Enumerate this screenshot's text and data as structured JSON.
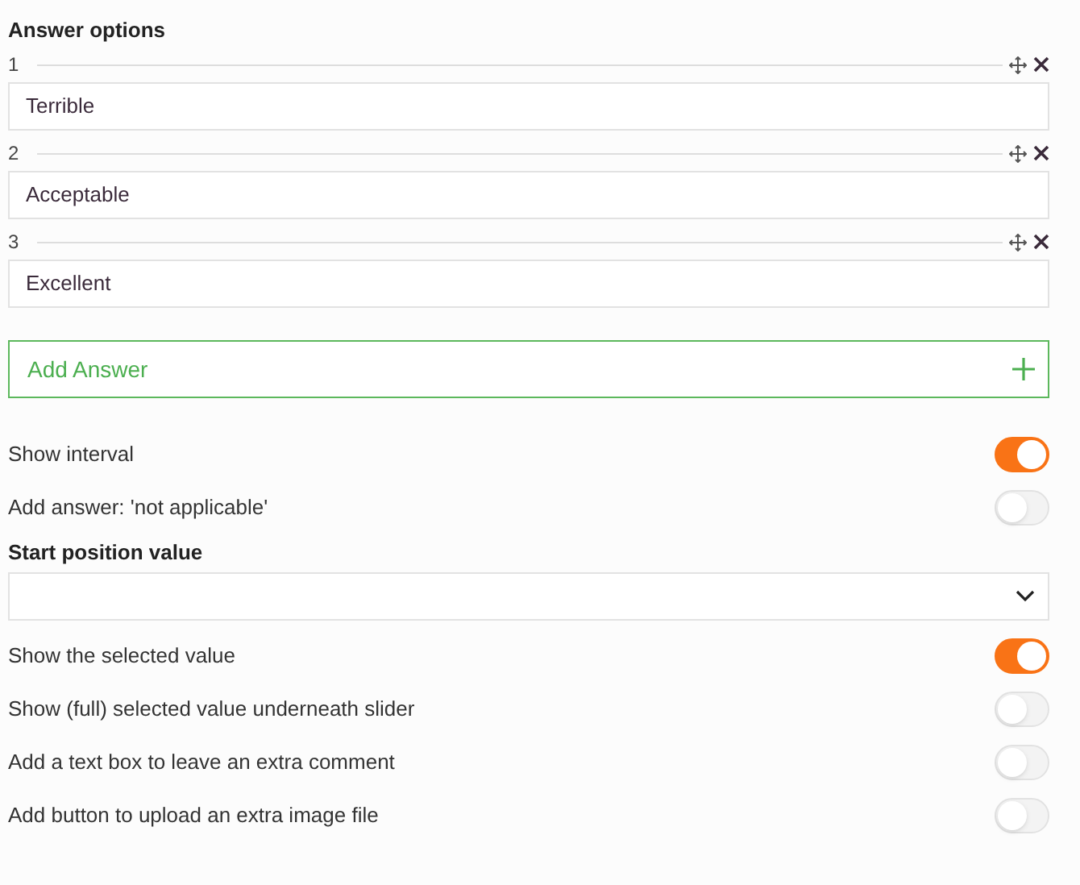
{
  "answer_options": {
    "title": "Answer options",
    "answers": [
      {
        "number": "1",
        "value": "Terrible"
      },
      {
        "number": "2",
        "value": "Acceptable"
      },
      {
        "number": "3",
        "value": "Excellent"
      }
    ],
    "add_button": "Add Answer"
  },
  "settings_top": [
    {
      "label": "Show interval",
      "on": true
    },
    {
      "label": "Add answer: 'not applicable'",
      "on": false
    }
  ],
  "start_position": {
    "label": "Start position value"
  },
  "settings_bottom": [
    {
      "label": "Show the selected value",
      "on": true
    },
    {
      "label": "Show (full) selected value underneath slider",
      "on": false
    },
    {
      "label": "Add a text box to leave an extra comment",
      "on": false
    },
    {
      "label": "Add button to upload an extra image file",
      "on": false
    }
  ]
}
